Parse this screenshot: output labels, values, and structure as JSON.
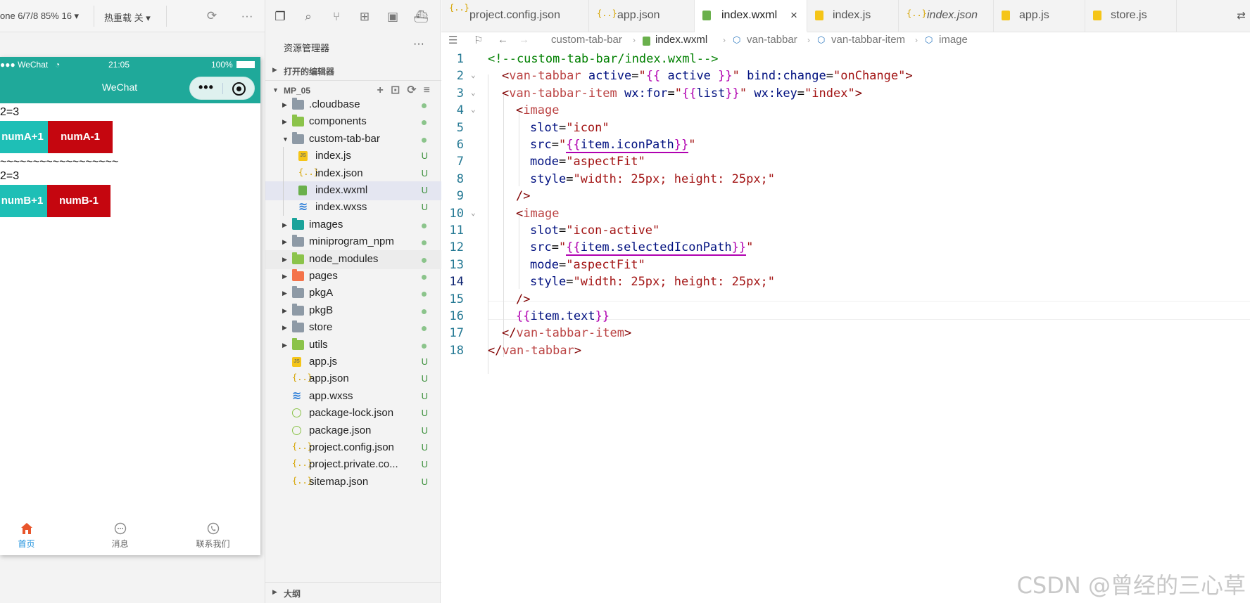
{
  "simulator": {
    "device_label": "one 6/7/8 85% 16 ▾",
    "hot_reload_label": "热重载 关 ▾",
    "status_carrier": "●●● WeChat",
    "status_time": "21:05",
    "status_battery": "100%",
    "nav_title": "WeChat",
    "capsule_dots": "•••",
    "line_a": "2=3",
    "btn_a_plus": "numA+1",
    "btn_a_minus": "numA-1",
    "tilde_line": "~~~~~~~~~~~~~~~~~~",
    "line_b": "2=3",
    "btn_b_plus": "numB+1",
    "btn_b_minus": "numB-1",
    "tabs": [
      {
        "label": "首页",
        "icon": "home-icon",
        "active": true
      },
      {
        "label": "消息",
        "icon": "message-icon",
        "active": false
      },
      {
        "label": "联系我们",
        "icon": "contact-icon",
        "active": false
      }
    ]
  },
  "explorer": {
    "title": "资源管理器",
    "open_editors": "打开的编辑器",
    "project": "MP_05",
    "outline": "大纲",
    "items": [
      {
        "name": ".cloudbase",
        "type": "folder",
        "status": "dot"
      },
      {
        "name": "components",
        "type": "folder",
        "status": "dot"
      },
      {
        "name": "custom-tab-bar",
        "type": "folder",
        "status": "dot"
      },
      {
        "name": "index.js",
        "type": "js",
        "status": "U"
      },
      {
        "name": "index.json",
        "type": "json",
        "status": "U"
      },
      {
        "name": "index.wxml",
        "type": "wxml",
        "status": "U"
      },
      {
        "name": "index.wxss",
        "type": "wxss",
        "status": "U"
      },
      {
        "name": "images",
        "type": "folder",
        "status": "dot"
      },
      {
        "name": "miniprogram_npm",
        "type": "folder",
        "status": "dot"
      },
      {
        "name": "node_modules",
        "type": "folder",
        "status": "dot"
      },
      {
        "name": "pages",
        "type": "folder",
        "status": "dot"
      },
      {
        "name": "pkgA",
        "type": "folder",
        "status": "dot"
      },
      {
        "name": "pkgB",
        "type": "folder",
        "status": "dot"
      },
      {
        "name": "store",
        "type": "folder",
        "status": "dot"
      },
      {
        "name": "utils",
        "type": "folder",
        "status": "dot"
      },
      {
        "name": "app.js",
        "type": "js",
        "status": "U"
      },
      {
        "name": "app.json",
        "type": "json",
        "status": "U"
      },
      {
        "name": "app.wxss",
        "type": "wxss",
        "status": "U"
      },
      {
        "name": "package-lock.json",
        "type": "node",
        "status": "U"
      },
      {
        "name": "package.json",
        "type": "node",
        "status": "U"
      },
      {
        "name": "project.config.json",
        "type": "json",
        "status": "U"
      },
      {
        "name": "project.private.co...",
        "type": "json",
        "status": "U"
      },
      {
        "name": "sitemap.json",
        "type": "json",
        "status": "U"
      }
    ]
  },
  "editor": {
    "tabs": [
      {
        "label": "project.config.json",
        "type": "json"
      },
      {
        "label": "app.json",
        "type": "json"
      },
      {
        "label": "index.wxml",
        "type": "wxml",
        "active": true
      },
      {
        "label": "index.js",
        "type": "js"
      },
      {
        "label": "index.json",
        "type": "json",
        "italic": true
      },
      {
        "label": "app.js",
        "type": "js"
      },
      {
        "label": "store.js",
        "type": "js"
      }
    ],
    "breadcrumb": [
      "custom-tab-bar",
      "index.wxml",
      "van-tabbar",
      "van-tabbar-item",
      "image"
    ],
    "lines": [
      "<!--custom-tab-bar/index.wxml-->",
      "<van-tabbar active=\"{{ active }}\" bind:change=\"onChange\">",
      "<van-tabbar-item wx:for=\"{{list}}\" wx:key=\"index\">",
      "<image",
      "slot=\"icon\"",
      "src=\"{{item.iconPath}}\"",
      "mode=\"aspectFit\"",
      "style=\"width: 25px; height: 25px;\"",
      "/>",
      "<image",
      "slot=\"icon-active\"",
      "src=\"{{item.selectedIconPath}}\"",
      "mode=\"aspectFit\"",
      "style=\"width: 25px; height: 25px;\"",
      "/>",
      "{{item.text}}",
      "</van-tabbar-item>",
      "</van-tabbar>"
    ],
    "line_numbers": [
      "1",
      "2",
      "3",
      "4",
      "5",
      "6",
      "7",
      "8",
      "9",
      "10",
      "11",
      "12",
      "13",
      "14",
      "15",
      "16",
      "17",
      "18"
    ],
    "current_line": "14"
  },
  "watermark": "CSDN @曾经的三心草",
  "colors": {
    "teal": "#1ebfb6",
    "red": "#c5060f",
    "nav_bg": "#1fa99a",
    "active_tab": "#1a8fdc"
  }
}
